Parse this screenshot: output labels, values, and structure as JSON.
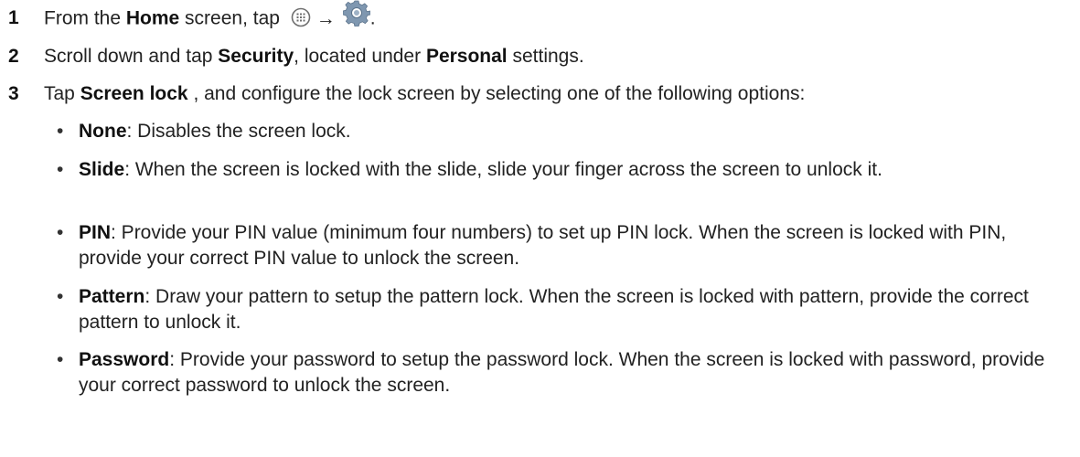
{
  "steps": [
    {
      "number": "1",
      "prefix": "From the ",
      "bold1": "Home",
      "middle": " screen, tap ",
      "arrow": "→",
      "suffix": ".",
      "icons": [
        "apps-icon",
        "settings-gear-icon"
      ]
    },
    {
      "number": "2",
      "prefix": "Scroll down and tap ",
      "bold1": "Security",
      "middle": ", located under ",
      "bold2": "Personal",
      "suffix": " settings."
    },
    {
      "number": "3",
      "prefix": "Tap ",
      "bold1": "Screen lock",
      "suffix": " , and configure the lock screen by selecting one of the following options:"
    }
  ],
  "options": [
    {
      "bullet": "•",
      "term": "None",
      "description": ": Disables the screen lock."
    },
    {
      "bullet": "•",
      "term": "Slide",
      "description": ": When the screen is locked with the slide, slide your finger across the screen to unlock it."
    },
    {
      "bullet": "•",
      "term": "PIN",
      "description": ": Provide your PIN value (minimum four numbers) to set up PIN lock. When the screen is locked with PIN, provide your correct PIN value to unlock the screen."
    },
    {
      "bullet": "•",
      "term": "Pattern",
      "description": ": Draw your pattern to setup the pattern lock. When the screen is locked with pattern, provide the correct pattern to unlock it."
    },
    {
      "bullet": "•",
      "term": "Password",
      "description": ": Provide your password to setup the password lock. When the screen is locked with password, provide your correct password to unlock the screen."
    }
  ],
  "colors": {
    "icon_gray": "#6e6e6e",
    "gear_blue": "#7f97b0"
  }
}
